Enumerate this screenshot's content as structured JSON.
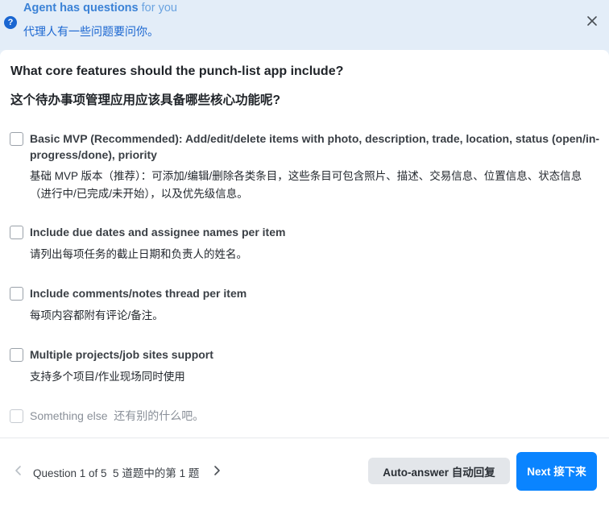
{
  "banner": {
    "title_en_strong": "Agent has questions",
    "title_en_rest": " for you",
    "title_zh": "代理人有一些问题要问你。",
    "close_icon": "close-icon"
  },
  "question": {
    "text_en": "What core features should the punch-list app include?",
    "text_zh": "这个待办事项管理应用应该具备哪些核心功能呢?"
  },
  "options": [
    {
      "label_en": "Basic MVP (Recommended): Add/edit/delete items with photo, description, trade, location, status (open/in-progress/done), priority",
      "label_zh": "基础 MVP 版本（推荐）：可添加/编辑/删除各类条目，这些条目可包含照片、描述、交易信息、位置信息、状态信息（进行中/已完成/未开始），以及优先级信息。",
      "checked": false
    },
    {
      "label_en": "Include due dates and assignee names per item",
      "label_zh": "请列出每项任务的截止日期和负责人的姓名。",
      "checked": false
    },
    {
      "label_en": "Include comments/notes thread per item",
      "label_zh": "每项内容都附有评论/备注。",
      "checked": false
    },
    {
      "label_en": "Multiple projects/job sites support",
      "label_zh": "支持多个项目/作业现场同时使用",
      "checked": false
    },
    {
      "label_en": "Something else  还有别的什么吧。",
      "checked": false
    }
  ],
  "footer": {
    "counter": "Question 1 of 5  5 道题中的第 1 题",
    "auto_answer_label": "Auto-answer 自动回复",
    "next_label": "Next 接下来"
  },
  "colors": {
    "accent": "#0a84ff",
    "banner_bg": "#e3edf8",
    "banner_text": "#1a66d1"
  }
}
